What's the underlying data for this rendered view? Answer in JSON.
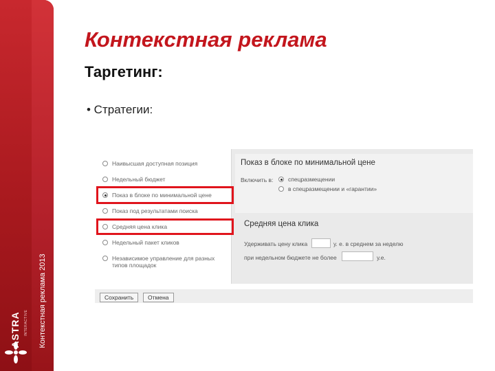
{
  "colors": {
    "accent": "#c3161d",
    "highlight": "#e0141c",
    "sidebar": "#b2202a"
  },
  "slide": {
    "title": "Контекстная реклама",
    "subtitle": "Таргетинг:",
    "bullet": "• Стратегии:",
    "side_caption": "Контекстная реклама 2013",
    "logo": {
      "text": "ASTRA",
      "sub": "INTERACTIVE"
    }
  },
  "strategies": {
    "options": [
      {
        "label": "Наивысшая доступная позиция",
        "checked": false,
        "highlighted": false
      },
      {
        "label": "Недельный бюджет",
        "checked": false,
        "highlighted": false
      },
      {
        "label": "Показ в блоке по минимальной цене",
        "checked": true,
        "highlighted": true
      },
      {
        "label": "Показ под результатами поиска",
        "checked": false,
        "highlighted": false
      },
      {
        "label": "Средняя цена клика",
        "checked": false,
        "highlighted": true
      },
      {
        "label": "Недельный пакет кликов",
        "checked": false,
        "highlighted": false
      },
      {
        "label": "Независимое управление для разных",
        "label2": "типов площадок",
        "checked": false,
        "highlighted": false
      }
    ]
  },
  "panel": {
    "block_title": "Показ в блоке по минимальной цене",
    "enable_label": "Включить в:",
    "place_options": [
      {
        "label": "спецразмещении",
        "checked": true
      },
      {
        "label": "в спецразмещении и «гарантии»",
        "checked": false
      }
    ],
    "cpc_title": "Средняя цена клика",
    "hold_label": "Удерживать цену клика",
    "hold_value": "",
    "hold_suffix": "у. е. в среднем за неделю",
    "budget_label": "при недельном бюджете не более",
    "budget_value": "",
    "budget_suffix": "у.е."
  },
  "buttons": {
    "save": "Сохранить",
    "cancel": "Отмена"
  }
}
